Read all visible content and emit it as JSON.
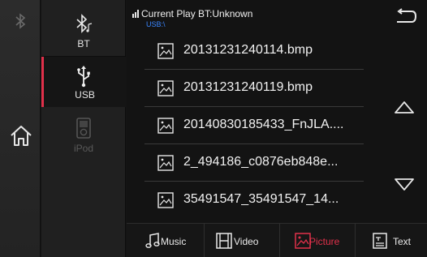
{
  "sources": {
    "bt_label": "BT",
    "usb_label": "USB",
    "ipod_label": "iPod"
  },
  "header": {
    "title": "Current Play BT:Unknown",
    "path": "USB:\\"
  },
  "files": [
    {
      "name": "20131231240114.bmp"
    },
    {
      "name": "20131231240119.bmp"
    },
    {
      "name": "20140830185433_FnJLA...."
    },
    {
      "name": "2_494186_c0876eb848e..."
    },
    {
      "name": "35491547_35491547_14..."
    }
  ],
  "tabs": {
    "music": "Music",
    "video": "Video",
    "picture": "Picture",
    "text": "Text",
    "active": "picture"
  },
  "colors": {
    "accent": "#e0304a",
    "path_blue": "#3a86ff",
    "background": "#131313"
  },
  "icons": {
    "rail_top": "bluetooth-icon",
    "rail_home": "home-icon",
    "back": "back-arrow-icon",
    "scroll_up": "scroll-up-icon",
    "scroll_down": "scroll-down-icon",
    "file": "image-file-icon"
  }
}
